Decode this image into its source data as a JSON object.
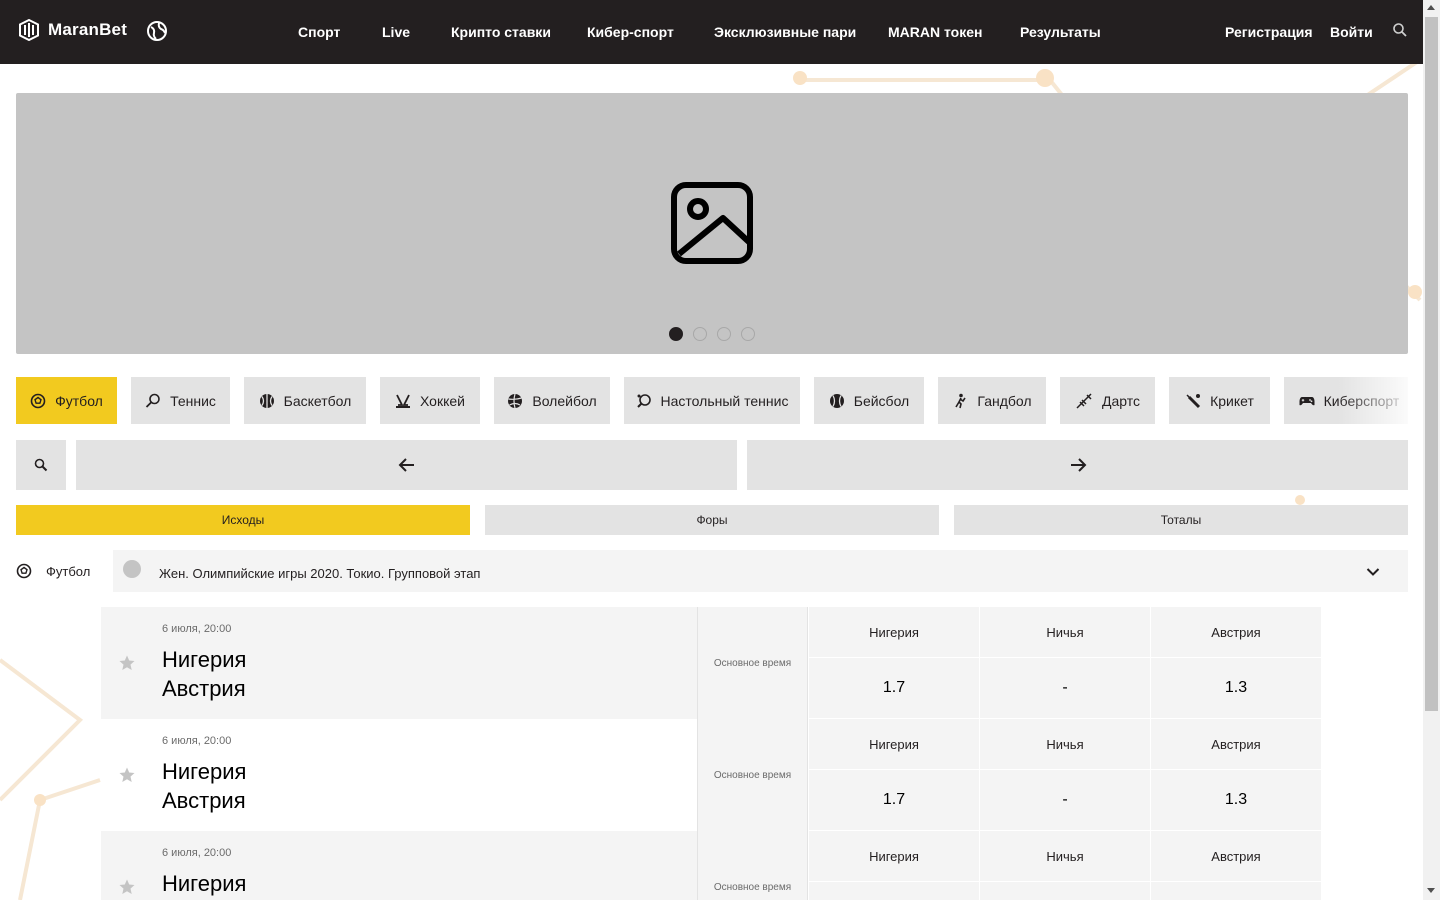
{
  "header": {
    "brand": "MaranBet",
    "nav": [
      "Спорт",
      "Live",
      "Крипто ставки",
      "Кибер-спорт",
      "Эксклюзивные пари",
      "MARAN токен",
      "Результаты"
    ],
    "register_label": "Регистрация",
    "login_label": "Войти"
  },
  "banner": {
    "slides_count": 4,
    "active_slide": 1
  },
  "sports": [
    {
      "label": "Футбол",
      "icon": "soccer-ball-icon",
      "active": true
    },
    {
      "label": "Теннис",
      "icon": "tennis-racket-icon"
    },
    {
      "label": "Баскетбол",
      "icon": "basketball-icon"
    },
    {
      "label": "Хоккей",
      "icon": "hockey-icon"
    },
    {
      "label": "Волейбол",
      "icon": "volleyball-icon"
    },
    {
      "label": "Настольный теннис",
      "icon": "table-tennis-icon"
    },
    {
      "label": "Бейсбол",
      "icon": "baseball-icon"
    },
    {
      "label": "Гандбол",
      "icon": "handball-icon"
    },
    {
      "label": "Дартс",
      "icon": "darts-icon"
    },
    {
      "label": "Крикет",
      "icon": "cricket-icon"
    },
    {
      "label": "Киберспорт",
      "icon": "gamepad-icon"
    }
  ],
  "market_tabs": [
    {
      "label": "Исходы",
      "active": true
    },
    {
      "label": "Форы"
    },
    {
      "label": "Тоталы"
    }
  ],
  "league": {
    "sport": "Футбол",
    "name": "Жен. Олимпийские игры 2020. Токио. Групповой этап"
  },
  "matches": [
    {
      "date": "6 июля, 20:00",
      "team1": "Нигерия",
      "team2": "Австрия",
      "period": "Основное время",
      "outcomes": [
        "Нигерия",
        "Ничья",
        "Австрия"
      ],
      "odds": [
        "1.7",
        "-",
        "1.3"
      ]
    },
    {
      "date": "6 июля, 20:00",
      "team1": "Нигерия",
      "team2": "Австрия",
      "period": "Основное время",
      "outcomes": [
        "Нигерия",
        "Ничья",
        "Австрия"
      ],
      "odds": [
        "1.7",
        "-",
        "1.3"
      ]
    },
    {
      "date": "6 июля, 20:00",
      "team1": "Нигерия",
      "team2": "",
      "period": "Основное время",
      "outcomes": [
        "Нигерия",
        "Ничья",
        "Австрия"
      ],
      "odds": [
        "",
        "",
        ""
      ]
    }
  ],
  "colors": {
    "header_bg": "#231f20",
    "accent": "#f2ca1f",
    "tab_bg": "#e3e3e3",
    "banner_bg": "#c4c4c4",
    "row_bg": "#f4f4f4"
  }
}
